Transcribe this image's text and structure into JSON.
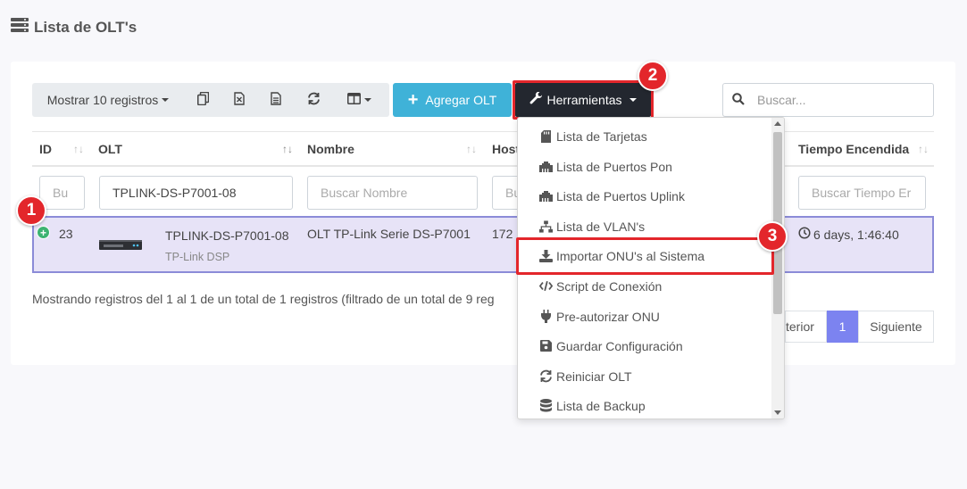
{
  "page": {
    "title": "Lista de OLT's"
  },
  "toolbar": {
    "show_records_label": "Mostrar 10 registros",
    "add_label": "Agregar OLT",
    "tools_label": "Herramientas"
  },
  "search": {
    "placeholder": "Buscar..."
  },
  "table": {
    "headers": {
      "id": "ID",
      "olt": "OLT",
      "nombre": "Nombre",
      "host": "Host",
      "tiempo": "Tiempo Encendida"
    },
    "filters": {
      "id": "Bu",
      "olt": "TPLINK-DS-P7001-08",
      "nombre": "Buscar Nombre",
      "host": "Bu",
      "tiempo": "Buscar Tiempo Er"
    },
    "row": {
      "id": "23",
      "olt_name": "TPLINK-DS-P7001-08",
      "olt_sub": "TP-Link DSP",
      "nombre": "OLT TP-Link Serie DS-P7001",
      "host": "172",
      "tiempo": "6 days, 1:46:40"
    }
  },
  "footer": {
    "info": "Mostrando registros del 1 al 1 de un total de 1 registros (filtrado de un total de 9 reg",
    "prev": "terior",
    "page": "1",
    "next": "Siguiente"
  },
  "dropdown": {
    "items": [
      {
        "label": "Lista de Tarjetas",
        "icon": "sd-card-icon"
      },
      {
        "label": "Lista de Puertos Pon",
        "icon": "ethernet-icon"
      },
      {
        "label": "Lista de Puertos Uplink",
        "icon": "ethernet-icon"
      },
      {
        "label": "Lista de VLAN's",
        "icon": "sitemap-icon"
      },
      {
        "label": "Importar ONU's al Sistema",
        "icon": "download-icon"
      },
      {
        "label": "Script de Conexión",
        "icon": "code-icon"
      },
      {
        "label": "Pre-autorizar ONU",
        "icon": "plug-icon"
      },
      {
        "label": "Guardar Configuración",
        "icon": "save-icon"
      },
      {
        "label": "Reiniciar OLT",
        "icon": "sync-icon"
      },
      {
        "label": "Lista de Backup",
        "icon": "database-icon"
      }
    ]
  },
  "annotations": {
    "step1": "1",
    "step2": "2",
    "step3": "3"
  },
  "colors": {
    "highlight_red": "#e3262b",
    "add_button": "#3fb2d8",
    "tools_button": "#23272f",
    "row_selected": "#e7e3f7",
    "pagination_active": "#7c83f0"
  }
}
